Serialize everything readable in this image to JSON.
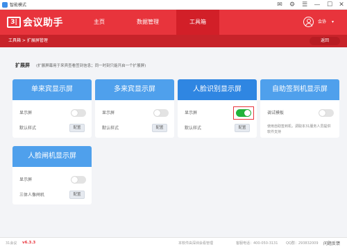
{
  "window": {
    "title": "智能模式"
  },
  "header": {
    "logo_mark": "3|",
    "logo_text": "会议助手",
    "nav": [
      {
        "label": "主页",
        "active": false
      },
      {
        "label": "数据管理",
        "active": false
      },
      {
        "label": "工具箱",
        "active": true
      }
    ],
    "user_name": "会协",
    "user_caret": "▾"
  },
  "breadcrumb": {
    "text": "工具箱 > 扩展屏管理",
    "back_label": "返回"
  },
  "section": {
    "title": "扩展屏",
    "description": "(扩展屏幕用于来宾查看签到信息；同一时刻只能开启一个扩展屏)"
  },
  "cards": [
    {
      "title": "单来宾显示屏",
      "row1_label": "显示屏",
      "toggle_on": false,
      "row2_label": "默认样式",
      "config_label": "配置"
    },
    {
      "title": "多来宾显示屏",
      "row1_label": "显示屏",
      "toggle_on": false,
      "row2_label": "默认样式",
      "config_label": "配置"
    },
    {
      "title": "人脸识别显示屏",
      "row1_label": "显示屏",
      "toggle_on": true,
      "row2_label": "默认样式",
      "config_label": "配置"
    },
    {
      "title": "自助签到机显示屏",
      "row1_label": "调试模板",
      "toggle_on": false,
      "description": "使用自助签到机，调取本31服务人员提供软件支持"
    },
    {
      "title": "人脸闸机显示屏",
      "row1_label": "显示屏",
      "toggle_on": false,
      "row2_label": "三体人像闸机",
      "config_label": "配置"
    }
  ],
  "footer": {
    "product": "31会议",
    "version": "v6.3.3",
    "company": "本软件由深圳会看管理",
    "phone": "客服电话：400-050-3131",
    "qq": "QQ群：293832009",
    "feedback": "问题反馈"
  },
  "colors": {
    "brand_red": "#e8343c",
    "card_blue": "#4fa0ec",
    "toggle_green": "#21b33a"
  }
}
